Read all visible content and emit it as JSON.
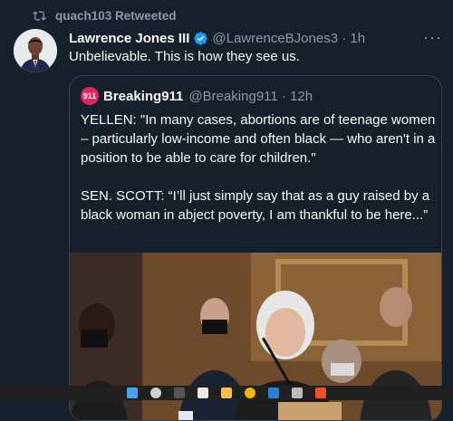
{
  "retweet": {
    "label": "quach103 Retweeted",
    "icon": "retweet-icon"
  },
  "tweet": {
    "author_name": "Lawrence Jones III",
    "handle_time": "@LawrenceBJones3 · 1h",
    "text": "Unbelievable. This is how they see us.",
    "more_icon": "more-icon"
  },
  "quote": {
    "logo_text": "911",
    "author_name": "Breaking911",
    "handle_time": "@Breaking911 · 12h",
    "text": "YELLEN: \"In many cases, abortions are of teenage women – particularly low-income and often black — who aren't in a position to be able to care for children.\"\n\nSEN. SCOTT: “I’ll just simply say that as a guy raised by a black woman in abject poverty, I am thankful to be here...”"
  },
  "colors": {
    "background": "#15202b",
    "muted": "#8b98a5",
    "accent": "#1d9bf0",
    "border": "#38444d"
  }
}
